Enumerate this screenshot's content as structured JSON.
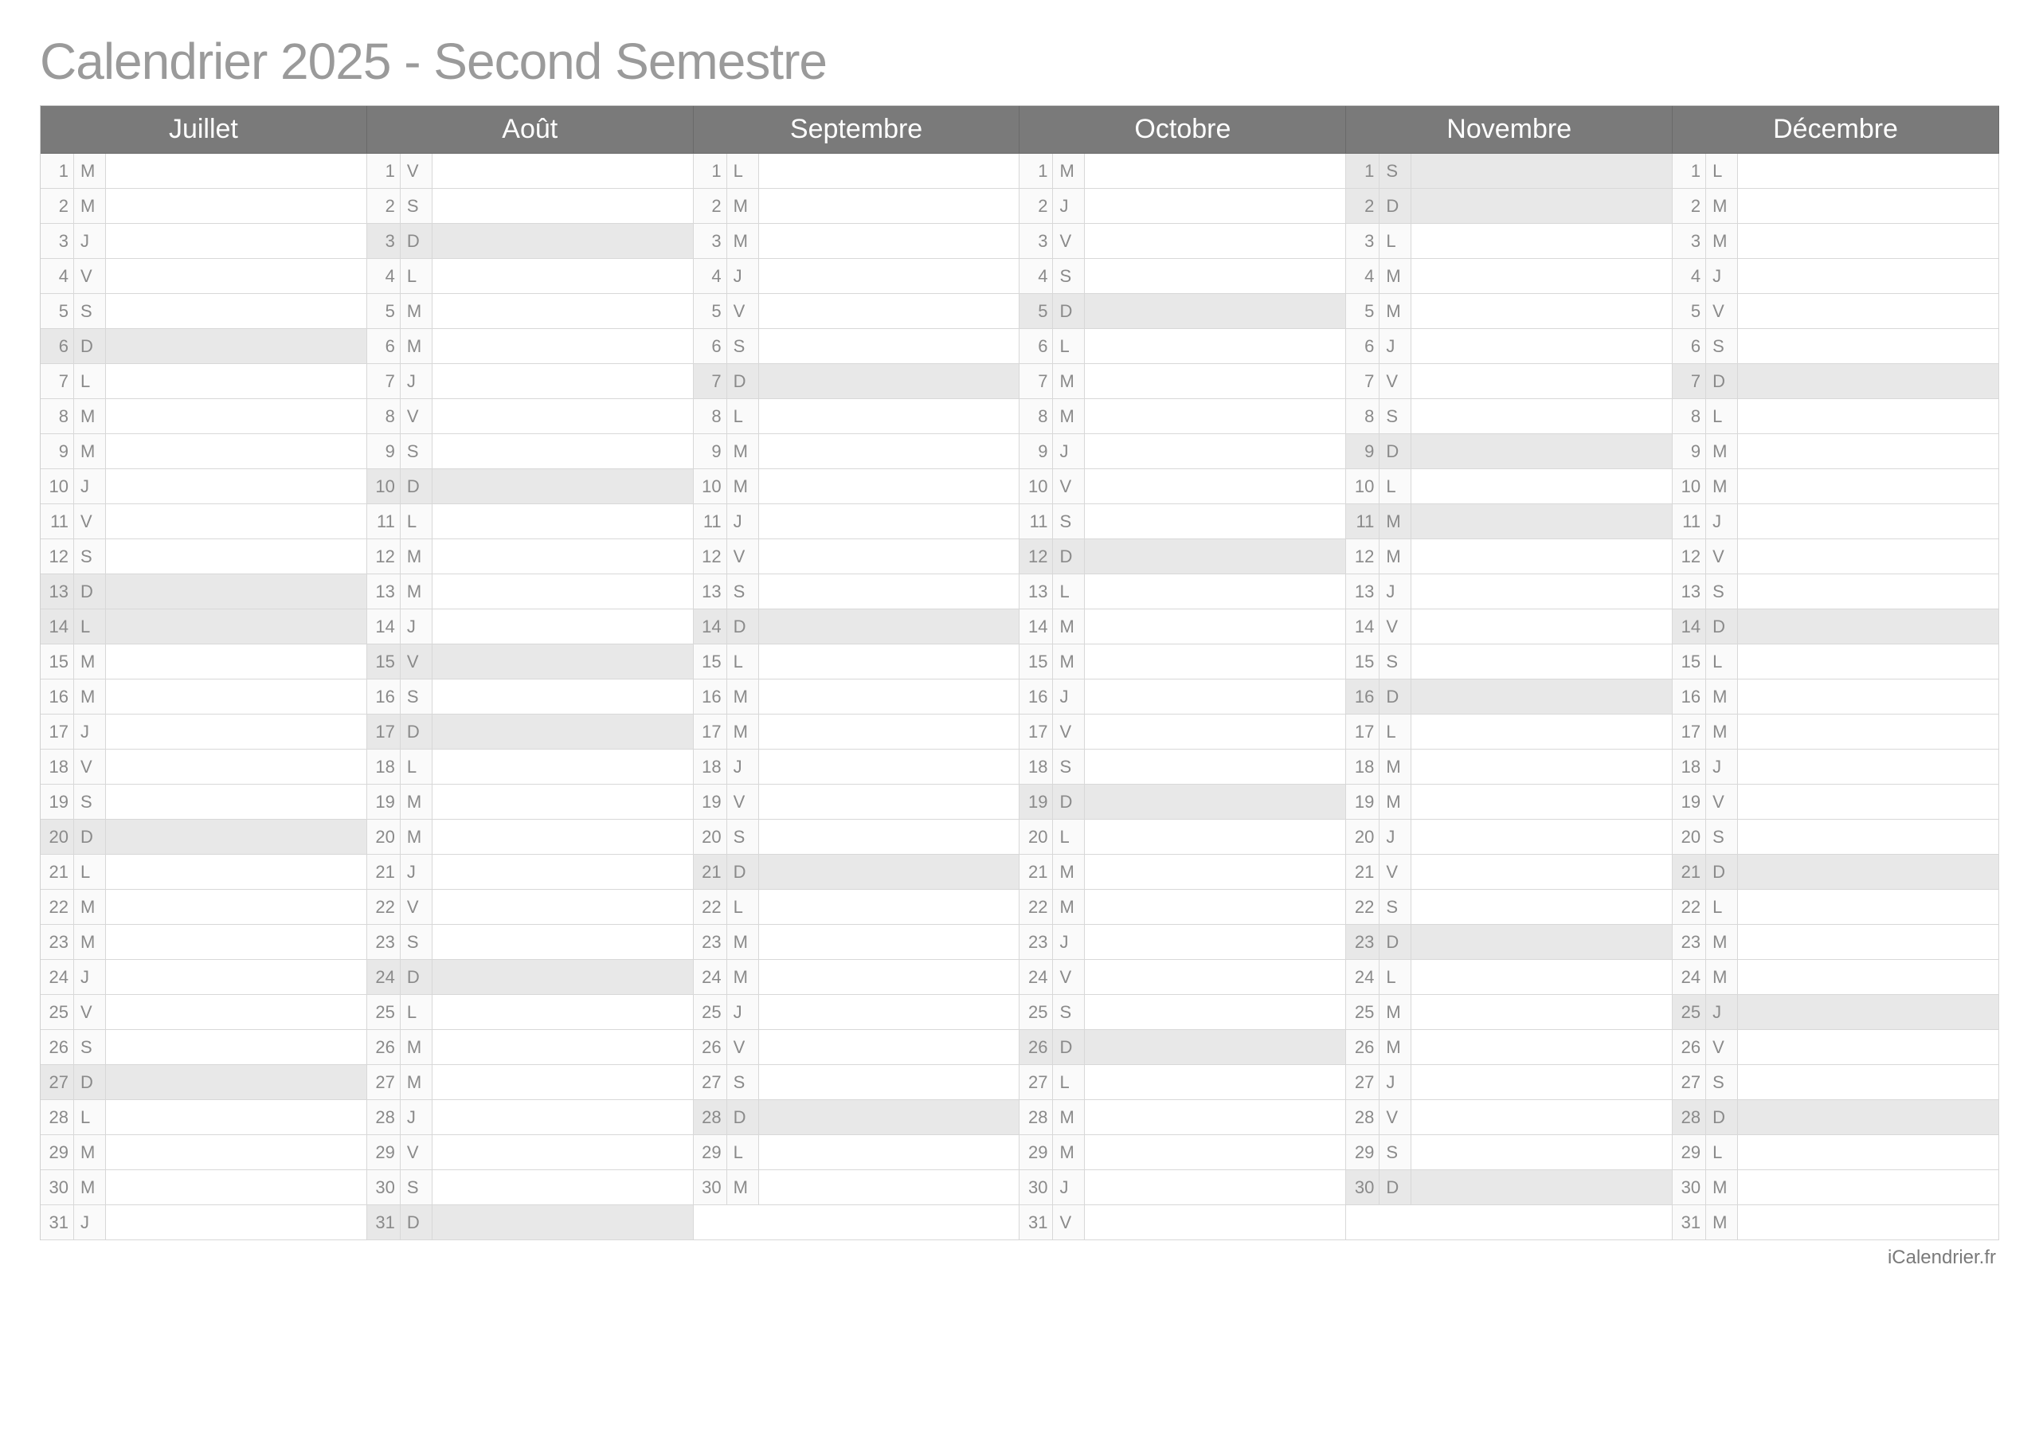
{
  "title": "Calendrier 2025 - Second Semestre",
  "footer": "iCalendrier.fr",
  "months": [
    {
      "name": "Juillet",
      "days": [
        {
          "n": 1,
          "d": "M",
          "s": false
        },
        {
          "n": 2,
          "d": "M",
          "s": false
        },
        {
          "n": 3,
          "d": "J",
          "s": false
        },
        {
          "n": 4,
          "d": "V",
          "s": false
        },
        {
          "n": 5,
          "d": "S",
          "s": false
        },
        {
          "n": 6,
          "d": "D",
          "s": true
        },
        {
          "n": 7,
          "d": "L",
          "s": false
        },
        {
          "n": 8,
          "d": "M",
          "s": false
        },
        {
          "n": 9,
          "d": "M",
          "s": false
        },
        {
          "n": 10,
          "d": "J",
          "s": false
        },
        {
          "n": 11,
          "d": "V",
          "s": false
        },
        {
          "n": 12,
          "d": "S",
          "s": false
        },
        {
          "n": 13,
          "d": "D",
          "s": true
        },
        {
          "n": 14,
          "d": "L",
          "s": true
        },
        {
          "n": 15,
          "d": "M",
          "s": false
        },
        {
          "n": 16,
          "d": "M",
          "s": false
        },
        {
          "n": 17,
          "d": "J",
          "s": false
        },
        {
          "n": 18,
          "d": "V",
          "s": false
        },
        {
          "n": 19,
          "d": "S",
          "s": false
        },
        {
          "n": 20,
          "d": "D",
          "s": true
        },
        {
          "n": 21,
          "d": "L",
          "s": false
        },
        {
          "n": 22,
          "d": "M",
          "s": false
        },
        {
          "n": 23,
          "d": "M",
          "s": false
        },
        {
          "n": 24,
          "d": "J",
          "s": false
        },
        {
          "n": 25,
          "d": "V",
          "s": false
        },
        {
          "n": 26,
          "d": "S",
          "s": false
        },
        {
          "n": 27,
          "d": "D",
          "s": true
        },
        {
          "n": 28,
          "d": "L",
          "s": false
        },
        {
          "n": 29,
          "d": "M",
          "s": false
        },
        {
          "n": 30,
          "d": "M",
          "s": false
        },
        {
          "n": 31,
          "d": "J",
          "s": false
        }
      ]
    },
    {
      "name": "Août",
      "days": [
        {
          "n": 1,
          "d": "V",
          "s": false
        },
        {
          "n": 2,
          "d": "S",
          "s": false
        },
        {
          "n": 3,
          "d": "D",
          "s": true
        },
        {
          "n": 4,
          "d": "L",
          "s": false
        },
        {
          "n": 5,
          "d": "M",
          "s": false
        },
        {
          "n": 6,
          "d": "M",
          "s": false
        },
        {
          "n": 7,
          "d": "J",
          "s": false
        },
        {
          "n": 8,
          "d": "V",
          "s": false
        },
        {
          "n": 9,
          "d": "S",
          "s": false
        },
        {
          "n": 10,
          "d": "D",
          "s": true
        },
        {
          "n": 11,
          "d": "L",
          "s": false
        },
        {
          "n": 12,
          "d": "M",
          "s": false
        },
        {
          "n": 13,
          "d": "M",
          "s": false
        },
        {
          "n": 14,
          "d": "J",
          "s": false
        },
        {
          "n": 15,
          "d": "V",
          "s": true
        },
        {
          "n": 16,
          "d": "S",
          "s": false
        },
        {
          "n": 17,
          "d": "D",
          "s": true
        },
        {
          "n": 18,
          "d": "L",
          "s": false
        },
        {
          "n": 19,
          "d": "M",
          "s": false
        },
        {
          "n": 20,
          "d": "M",
          "s": false
        },
        {
          "n": 21,
          "d": "J",
          "s": false
        },
        {
          "n": 22,
          "d": "V",
          "s": false
        },
        {
          "n": 23,
          "d": "S",
          "s": false
        },
        {
          "n": 24,
          "d": "D",
          "s": true
        },
        {
          "n": 25,
          "d": "L",
          "s": false
        },
        {
          "n": 26,
          "d": "M",
          "s": false
        },
        {
          "n": 27,
          "d": "M",
          "s": false
        },
        {
          "n": 28,
          "d": "J",
          "s": false
        },
        {
          "n": 29,
          "d": "V",
          "s": false
        },
        {
          "n": 30,
          "d": "S",
          "s": false
        },
        {
          "n": 31,
          "d": "D",
          "s": true
        }
      ]
    },
    {
      "name": "Septembre",
      "days": [
        {
          "n": 1,
          "d": "L",
          "s": false
        },
        {
          "n": 2,
          "d": "M",
          "s": false
        },
        {
          "n": 3,
          "d": "M",
          "s": false
        },
        {
          "n": 4,
          "d": "J",
          "s": false
        },
        {
          "n": 5,
          "d": "V",
          "s": false
        },
        {
          "n": 6,
          "d": "S",
          "s": false
        },
        {
          "n": 7,
          "d": "D",
          "s": true
        },
        {
          "n": 8,
          "d": "L",
          "s": false
        },
        {
          "n": 9,
          "d": "M",
          "s": false
        },
        {
          "n": 10,
          "d": "M",
          "s": false
        },
        {
          "n": 11,
          "d": "J",
          "s": false
        },
        {
          "n": 12,
          "d": "V",
          "s": false
        },
        {
          "n": 13,
          "d": "S",
          "s": false
        },
        {
          "n": 14,
          "d": "D",
          "s": true
        },
        {
          "n": 15,
          "d": "L",
          "s": false
        },
        {
          "n": 16,
          "d": "M",
          "s": false
        },
        {
          "n": 17,
          "d": "M",
          "s": false
        },
        {
          "n": 18,
          "d": "J",
          "s": false
        },
        {
          "n": 19,
          "d": "V",
          "s": false
        },
        {
          "n": 20,
          "d": "S",
          "s": false
        },
        {
          "n": 21,
          "d": "D",
          "s": true
        },
        {
          "n": 22,
          "d": "L",
          "s": false
        },
        {
          "n": 23,
          "d": "M",
          "s": false
        },
        {
          "n": 24,
          "d": "M",
          "s": false
        },
        {
          "n": 25,
          "d": "J",
          "s": false
        },
        {
          "n": 26,
          "d": "V",
          "s": false
        },
        {
          "n": 27,
          "d": "S",
          "s": false
        },
        {
          "n": 28,
          "d": "D",
          "s": true
        },
        {
          "n": 29,
          "d": "L",
          "s": false
        },
        {
          "n": 30,
          "d": "M",
          "s": false
        }
      ]
    },
    {
      "name": "Octobre",
      "days": [
        {
          "n": 1,
          "d": "M",
          "s": false
        },
        {
          "n": 2,
          "d": "J",
          "s": false
        },
        {
          "n": 3,
          "d": "V",
          "s": false
        },
        {
          "n": 4,
          "d": "S",
          "s": false
        },
        {
          "n": 5,
          "d": "D",
          "s": true
        },
        {
          "n": 6,
          "d": "L",
          "s": false
        },
        {
          "n": 7,
          "d": "M",
          "s": false
        },
        {
          "n": 8,
          "d": "M",
          "s": false
        },
        {
          "n": 9,
          "d": "J",
          "s": false
        },
        {
          "n": 10,
          "d": "V",
          "s": false
        },
        {
          "n": 11,
          "d": "S",
          "s": false
        },
        {
          "n": 12,
          "d": "D",
          "s": true
        },
        {
          "n": 13,
          "d": "L",
          "s": false
        },
        {
          "n": 14,
          "d": "M",
          "s": false
        },
        {
          "n": 15,
          "d": "M",
          "s": false
        },
        {
          "n": 16,
          "d": "J",
          "s": false
        },
        {
          "n": 17,
          "d": "V",
          "s": false
        },
        {
          "n": 18,
          "d": "S",
          "s": false
        },
        {
          "n": 19,
          "d": "D",
          "s": true
        },
        {
          "n": 20,
          "d": "L",
          "s": false
        },
        {
          "n": 21,
          "d": "M",
          "s": false
        },
        {
          "n": 22,
          "d": "M",
          "s": false
        },
        {
          "n": 23,
          "d": "J",
          "s": false
        },
        {
          "n": 24,
          "d": "V",
          "s": false
        },
        {
          "n": 25,
          "d": "S",
          "s": false
        },
        {
          "n": 26,
          "d": "D",
          "s": true
        },
        {
          "n": 27,
          "d": "L",
          "s": false
        },
        {
          "n": 28,
          "d": "M",
          "s": false
        },
        {
          "n": 29,
          "d": "M",
          "s": false
        },
        {
          "n": 30,
          "d": "J",
          "s": false
        },
        {
          "n": 31,
          "d": "V",
          "s": false
        }
      ]
    },
    {
      "name": "Novembre",
      "days": [
        {
          "n": 1,
          "d": "S",
          "s": true
        },
        {
          "n": 2,
          "d": "D",
          "s": true
        },
        {
          "n": 3,
          "d": "L",
          "s": false
        },
        {
          "n": 4,
          "d": "M",
          "s": false
        },
        {
          "n": 5,
          "d": "M",
          "s": false
        },
        {
          "n": 6,
          "d": "J",
          "s": false
        },
        {
          "n": 7,
          "d": "V",
          "s": false
        },
        {
          "n": 8,
          "d": "S",
          "s": false
        },
        {
          "n": 9,
          "d": "D",
          "s": true
        },
        {
          "n": 10,
          "d": "L",
          "s": false
        },
        {
          "n": 11,
          "d": "M",
          "s": true
        },
        {
          "n": 12,
          "d": "M",
          "s": false
        },
        {
          "n": 13,
          "d": "J",
          "s": false
        },
        {
          "n": 14,
          "d": "V",
          "s": false
        },
        {
          "n": 15,
          "d": "S",
          "s": false
        },
        {
          "n": 16,
          "d": "D",
          "s": true
        },
        {
          "n": 17,
          "d": "L",
          "s": false
        },
        {
          "n": 18,
          "d": "M",
          "s": false
        },
        {
          "n": 19,
          "d": "M",
          "s": false
        },
        {
          "n": 20,
          "d": "J",
          "s": false
        },
        {
          "n": 21,
          "d": "V",
          "s": false
        },
        {
          "n": 22,
          "d": "S",
          "s": false
        },
        {
          "n": 23,
          "d": "D",
          "s": true
        },
        {
          "n": 24,
          "d": "L",
          "s": false
        },
        {
          "n": 25,
          "d": "M",
          "s": false
        },
        {
          "n": 26,
          "d": "M",
          "s": false
        },
        {
          "n": 27,
          "d": "J",
          "s": false
        },
        {
          "n": 28,
          "d": "V",
          "s": false
        },
        {
          "n": 29,
          "d": "S",
          "s": false
        },
        {
          "n": 30,
          "d": "D",
          "s": true
        }
      ]
    },
    {
      "name": "Décembre",
      "days": [
        {
          "n": 1,
          "d": "L",
          "s": false
        },
        {
          "n": 2,
          "d": "M",
          "s": false
        },
        {
          "n": 3,
          "d": "M",
          "s": false
        },
        {
          "n": 4,
          "d": "J",
          "s": false
        },
        {
          "n": 5,
          "d": "V",
          "s": false
        },
        {
          "n": 6,
          "d": "S",
          "s": false
        },
        {
          "n": 7,
          "d": "D",
          "s": true
        },
        {
          "n": 8,
          "d": "L",
          "s": false
        },
        {
          "n": 9,
          "d": "M",
          "s": false
        },
        {
          "n": 10,
          "d": "M",
          "s": false
        },
        {
          "n": 11,
          "d": "J",
          "s": false
        },
        {
          "n": 12,
          "d": "V",
          "s": false
        },
        {
          "n": 13,
          "d": "S",
          "s": false
        },
        {
          "n": 14,
          "d": "D",
          "s": true
        },
        {
          "n": 15,
          "d": "L",
          "s": false
        },
        {
          "n": 16,
          "d": "M",
          "s": false
        },
        {
          "n": 17,
          "d": "M",
          "s": false
        },
        {
          "n": 18,
          "d": "J",
          "s": false
        },
        {
          "n": 19,
          "d": "V",
          "s": false
        },
        {
          "n": 20,
          "d": "S",
          "s": false
        },
        {
          "n": 21,
          "d": "D",
          "s": true
        },
        {
          "n": 22,
          "d": "L",
          "s": false
        },
        {
          "n": 23,
          "d": "M",
          "s": false
        },
        {
          "n": 24,
          "d": "M",
          "s": false
        },
        {
          "n": 25,
          "d": "J",
          "s": true
        },
        {
          "n": 26,
          "d": "V",
          "s": false
        },
        {
          "n": 27,
          "d": "S",
          "s": false
        },
        {
          "n": 28,
          "d": "D",
          "s": true
        },
        {
          "n": 29,
          "d": "L",
          "s": false
        },
        {
          "n": 30,
          "d": "M",
          "s": false
        },
        {
          "n": 31,
          "d": "M",
          "s": false
        }
      ]
    }
  ]
}
